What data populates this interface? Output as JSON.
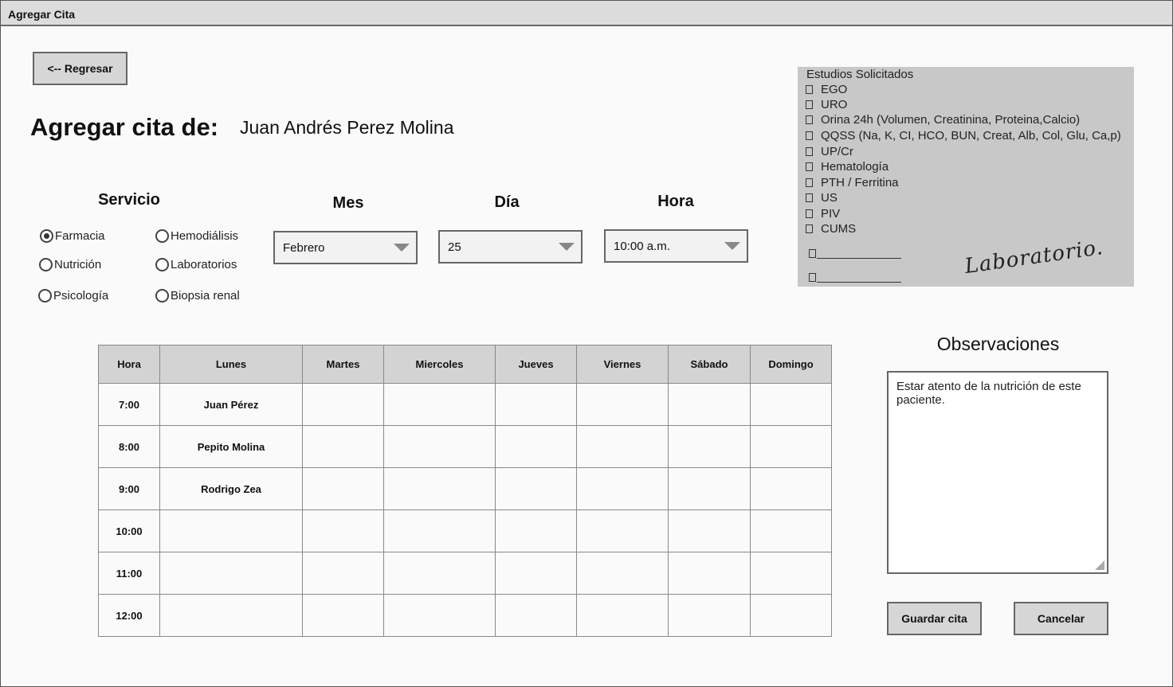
{
  "window": {
    "title": "Agregar Cita"
  },
  "buttons": {
    "back": "<-- Regresar",
    "save": "Guardar cita",
    "cancel": "Cancelar"
  },
  "header": {
    "label": "Agregar cita de:",
    "patient_name": "Juan Andrés Perez Molina"
  },
  "service": {
    "label": "Servicio",
    "options": [
      "Farmacia",
      "Hemodiálisis",
      "Nutrición",
      "Laboratorios",
      "Psicología",
      "Biopsia renal"
    ],
    "selected": "Farmacia"
  },
  "month": {
    "label": "Mes",
    "value": "Febrero"
  },
  "day": {
    "label": "Día",
    "value": "25"
  },
  "hour": {
    "label": "Hora",
    "value": "10:00 a.m."
  },
  "studies": {
    "title": "Estudios Solicitados",
    "items": [
      "EGO",
      "URO",
      "Orina 24h (Volumen, Creatinina,  Proteina,Calcio)",
      "QQSS (Na, K, CI, HCO, BUN, Creat, Alb, Col, Glu, Ca,p)",
      "UP/Cr",
      "Hematología",
      "PTH / Ferritina",
      "US",
      "PIV",
      "CUMS"
    ],
    "signature": "Laboratorio."
  },
  "schedule": {
    "columns": [
      "Hora",
      "Lunes",
      "Martes",
      "Miercoles",
      "Jueves",
      "Viernes",
      "Sábado",
      "Domingo"
    ],
    "rows": [
      [
        "7:00",
        "Juan Pérez",
        "",
        "",
        "",
        "",
        "",
        ""
      ],
      [
        "8:00",
        "Pepito Molina",
        "",
        "",
        "",
        "",
        "",
        ""
      ],
      [
        "9:00",
        "Rodrigo Zea",
        "",
        "",
        "",
        "",
        "",
        ""
      ],
      [
        "10:00",
        "",
        "",
        "",
        "",
        "",
        "",
        ""
      ],
      [
        "11:00",
        "",
        "",
        "",
        "",
        "",
        "",
        ""
      ],
      [
        "12:00",
        "",
        "",
        "",
        "",
        "",
        "",
        ""
      ]
    ]
  },
  "observations": {
    "label": "Observaciones",
    "text": "Estar atento de la nutrición de este paciente."
  }
}
